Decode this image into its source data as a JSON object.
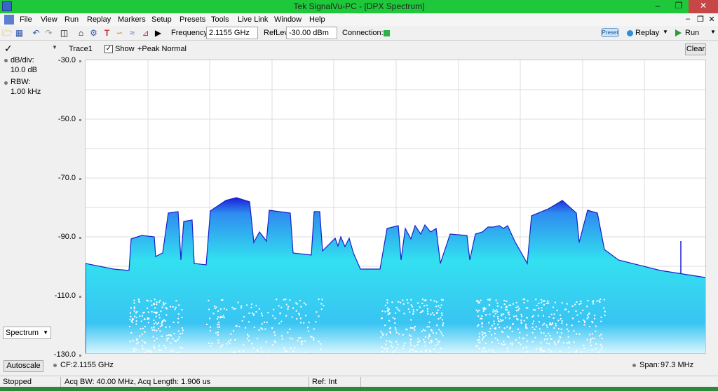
{
  "window": {
    "title": "Tek SignalVu-PC - [DPX Spectrum]"
  },
  "menu": {
    "items": [
      "File",
      "View",
      "Run",
      "Replay",
      "Markers",
      "Setup",
      "Presets",
      "Tools",
      "Live Link",
      "Window",
      "Help"
    ]
  },
  "toolbar": {
    "frequency_label": "Frequency:",
    "frequency_value": "2.1155 GHz",
    "reflev_label": "RefLev:",
    "reflev_value": "-30.00 dBm",
    "connection_label": "Connection:",
    "connection_color": "#2db14c",
    "preset_label": "Preset",
    "replay_label": "Replay",
    "run_label": "Run"
  },
  "trace": {
    "name": "Trace1",
    "show_label": "Show",
    "show_checked": true,
    "detection": "+Peak Normal",
    "clear_label": "Clear"
  },
  "left_panel": {
    "dbdiv_label": "dB/div:",
    "dbdiv_value": "10.0 dB",
    "rbw_label": "RBW:",
    "rbw_value": "1.00 kHz",
    "display_select": "Spectrum",
    "autoscale_label": "Autoscale"
  },
  "plot": {
    "y_ticks": [
      "-30.0",
      "-50.0",
      "-70.0",
      "-90.0",
      "-110.0",
      "-130.0"
    ],
    "cf_label": "CF:",
    "cf_value": "2.1155 GHz",
    "span_label": "Span:",
    "span_value": "97.3 MHz",
    "colors": {
      "trace_top": "#1a1fd8",
      "mid": "#2f8cf0",
      "low": "#33e0f0",
      "floor": "#dff8ff"
    }
  },
  "status": {
    "state": "Stopped",
    "acq": "Acq BW: 40.00 MHz, Acq Length: 1.906 us",
    "ref": "Ref: Int"
  }
}
